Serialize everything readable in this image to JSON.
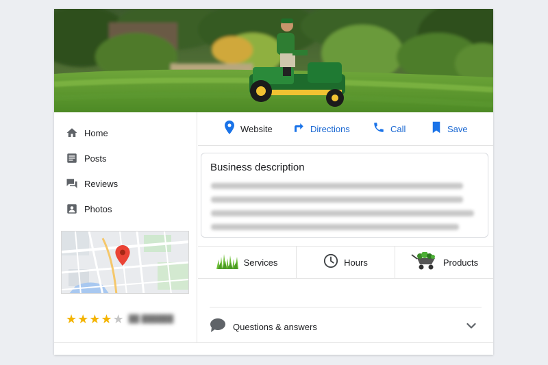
{
  "nav": {
    "items": [
      {
        "label": "Home",
        "icon": "home-icon"
      },
      {
        "label": "Posts",
        "icon": "posts-icon"
      },
      {
        "label": "Reviews",
        "icon": "reviews-icon"
      },
      {
        "label": "Photos",
        "icon": "photos-icon"
      }
    ]
  },
  "actions": {
    "website": "Website",
    "directions": "Directions",
    "call": "Call",
    "save": "Save"
  },
  "description": {
    "title": "Business description"
  },
  "tiles": {
    "services": "Services",
    "hours": "Hours",
    "products": "Products"
  },
  "qa": {
    "label": "Questions & answers"
  },
  "rating": {
    "stars": 4,
    "max": 5
  },
  "colors": {
    "accent_blue": "#1a73e8",
    "link_blue": "#1967d2",
    "star_gold": "#f4b400",
    "star_gray": "#c6c6c6",
    "icon_gray": "#5f6368",
    "map_pin_red": "#ea4335"
  }
}
